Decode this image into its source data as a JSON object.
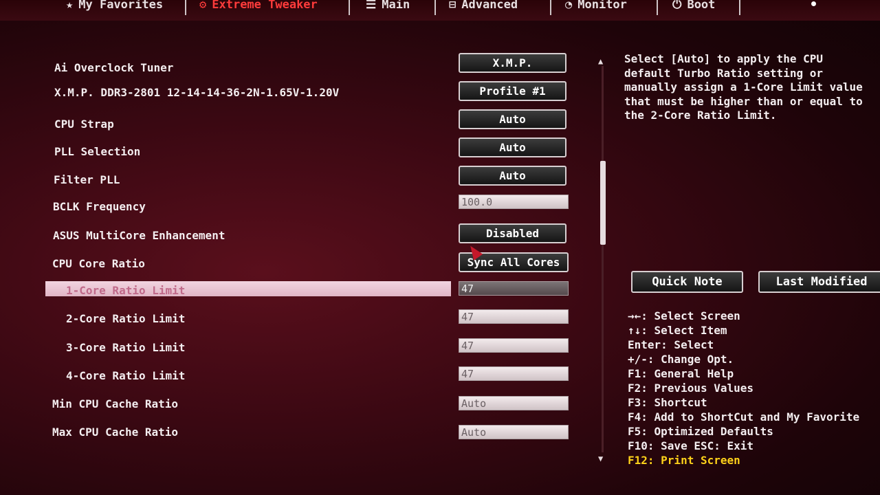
{
  "tabs": [
    {
      "label": "My Favorites",
      "icon": "star-icon",
      "active": false
    },
    {
      "label": "Extreme Tweaker",
      "icon": "tweaker-icon",
      "active": true
    },
    {
      "label": "Main",
      "icon": "menu-icon",
      "active": false
    },
    {
      "label": "Advanced",
      "icon": "advanced-icon",
      "active": false
    },
    {
      "label": "Monitor",
      "icon": "monitor-icon",
      "active": false
    },
    {
      "label": "Boot",
      "icon": "power-icon",
      "active": false
    }
  ],
  "settings": [
    {
      "label": "Ai Overclock Tuner",
      "value": "X.M.P."
    },
    {
      "label": "X.M.P. DDR3-2801 12-14-14-36-2N-1.65V-1.20V",
      "value": "Profile #1"
    },
    {
      "label": "CPU Strap",
      "value": "Auto"
    },
    {
      "label": "PLL Selection",
      "value": "Auto"
    },
    {
      "label": "Filter PLL",
      "value": "Auto"
    },
    {
      "label": "BCLK Frequency",
      "value": "100.0"
    },
    {
      "label": "ASUS MultiCore Enhancement",
      "value": "Disabled"
    },
    {
      "label": "CPU Core Ratio",
      "value": "Sync All Cores"
    },
    {
      "label": "1-Core Ratio Limit",
      "value": "47"
    },
    {
      "label": "2-Core Ratio Limit",
      "value": "47"
    },
    {
      "label": "3-Core Ratio Limit",
      "value": "47"
    },
    {
      "label": "4-Core Ratio Limit",
      "value": "47"
    },
    {
      "label": "Min CPU Cache Ratio",
      "value": "Auto"
    },
    {
      "label": "Max CPU Cache Ratio",
      "value": "Auto"
    }
  ],
  "help_text": "Select [Auto] to apply the CPU\ndefault Turbo Ratio setting or\nmanually assign a 1-Core Limit value\nthat must be higher than or equal to\nthe 2-Core Ratio Limit.",
  "buttons": {
    "quick_note": "Quick Note",
    "last_modified": "Last Modified"
  },
  "keys": [
    "→←: Select Screen",
    "↑↓: Select Item",
    "Enter: Select",
    "+/-: Change Opt.",
    "F1: General Help",
    "F2: Previous Values",
    "F3: Shortcut",
    "F4: Add to ShortCut and My Favorite",
    "F5: Optimized Defaults",
    "F10: Save  ESC: Exit",
    "F12: Print Screen"
  ],
  "colors": {
    "active_tab": "#ff3b3b",
    "highlight": "#f2d4e0",
    "key_accent": "#ffd21a"
  }
}
